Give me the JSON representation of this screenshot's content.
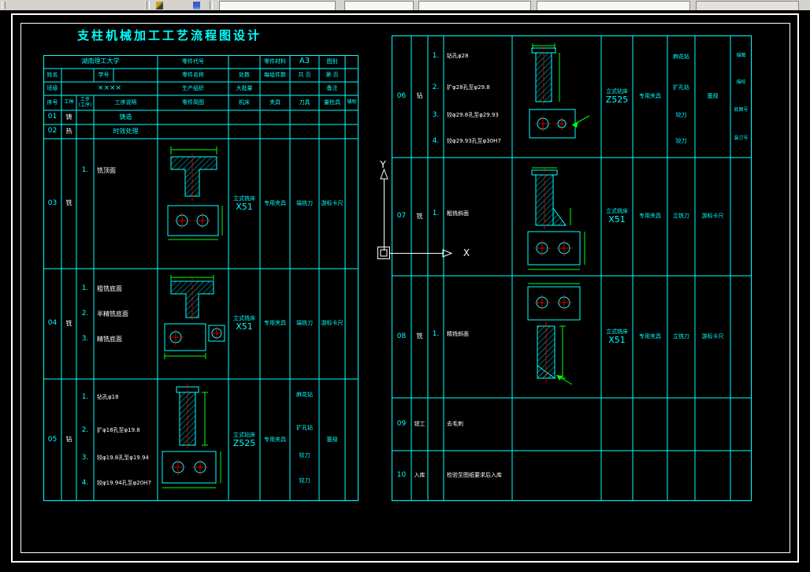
{
  "title": "支柱机械加工工艺流程图设计",
  "colors": {
    "grid_line": "#00ffff",
    "secondary_text": "#ffffff",
    "dimension": "#00ff00",
    "centerline": "#ff0000",
    "toolbar_bg": "#d6d3ce"
  },
  "ucs": {
    "x_label": "X",
    "y_label": "Y"
  },
  "title_block": {
    "school": "湖南理工大学",
    "part_code_label": "零件代号",
    "part_material_label": "零件材料",
    "sheet_size": "A3",
    "drawing_type_label": "图别",
    "name_label": "姓名",
    "student_no_label": "学号",
    "part_name_label": "零件名称",
    "sites_label": "处数",
    "per_group_label": "每组件数",
    "total_pages_label": "共 页",
    "page_no_label": "第 页",
    "class_label": "班级",
    "class_value": "××××",
    "production_org_label": "生产组织",
    "batch_label": "大批量",
    "remark_label": "备注",
    "col_seq": "序号",
    "col_trade": "工种",
    "col_step_line1": "工步",
    "col_step_line2": "(工序)",
    "col_desc": "工序说明",
    "col_sketch": "零件简图",
    "col_machine": "机床",
    "col_fixture": "夹具",
    "col_tool": "刀具",
    "col_gauge": "量检具",
    "col_aux": "辅助"
  },
  "left_rows": [
    {
      "no": "01",
      "trade": "铸",
      "desc": "铸造"
    },
    {
      "no": "02",
      "trade": "热",
      "desc": "时效处理"
    },
    {
      "no": "03",
      "trade": "铣",
      "steps": [
        "1."
      ],
      "descs": [
        "铣顶面"
      ],
      "machine_name": "立式铣床",
      "machine_model": "X51",
      "fixture": "专用夹具",
      "tools": [
        "端铣刀"
      ],
      "gauge": "游标卡尺"
    },
    {
      "no": "04",
      "trade": "铣",
      "steps": [
        "1.",
        "2.",
        "3."
      ],
      "descs": [
        "粗铣底面",
        "半精铣底面",
        "精铣底面"
      ],
      "machine_name": "立式铣床",
      "machine_model": "X51",
      "fixture": "专用夹具",
      "tools": [
        "端铣刀"
      ],
      "gauge": "游标卡尺"
    },
    {
      "no": "05",
      "trade": "钻",
      "steps": [
        "1.",
        "2.",
        "3.",
        "4."
      ],
      "descs": [
        "钻孔φ18",
        "扩φ18孔至φ19.8",
        "铰φ19.8孔至φ19.94",
        "铰φ19.94孔至φ20H7"
      ],
      "machine_name": "立式钻床",
      "machine_model": "Z525",
      "fixture": "专用夹具",
      "tools": [
        "麻花钻",
        "扩孔钻",
        "铰刀",
        "铰刀"
      ],
      "gauge": "塞规"
    }
  ],
  "right_rows": [
    {
      "no": "06",
      "trade": "钻",
      "steps": [
        "1.",
        "2.",
        "3.",
        "4."
      ],
      "descs": [
        "钻孔φ28",
        "扩φ28孔至φ29.8",
        "铰φ29.8孔至φ29.93",
        "铰φ29.93孔至φ30H7"
      ],
      "machine_name": "立式钻床",
      "machine_model": "Z525",
      "fixture": "专用夹具",
      "tools": [
        "麻花钻",
        "扩孔钻",
        "铰刀",
        "铰刀"
      ],
      "gauge": "塞规",
      "margin_labels": [
        "描图",
        "描校",
        "底图号",
        "装订号"
      ]
    },
    {
      "no": "07",
      "trade": "铣",
      "steps": [
        "1."
      ],
      "descs": [
        "粗铣斜面"
      ],
      "machine_name": "立式铣床",
      "machine_model": "X51",
      "fixture": "专用夹具",
      "tools": [
        "立铣刀"
      ],
      "gauge": "游标卡尺"
    },
    {
      "no": "08",
      "trade": "铣",
      "steps": [
        "1."
      ],
      "descs": [
        "精铣斜面"
      ],
      "machine_name": "立式铣床",
      "machine_model": "X51",
      "fixture": "专用夹具",
      "tools": [
        "立铣刀"
      ],
      "gauge": "游标卡尺"
    },
    {
      "no": "09",
      "trade": "钳工",
      "desc": "去毛刺"
    },
    {
      "no": "10",
      "trade": "入库",
      "desc": "检验至图纸要求后入库"
    }
  ]
}
